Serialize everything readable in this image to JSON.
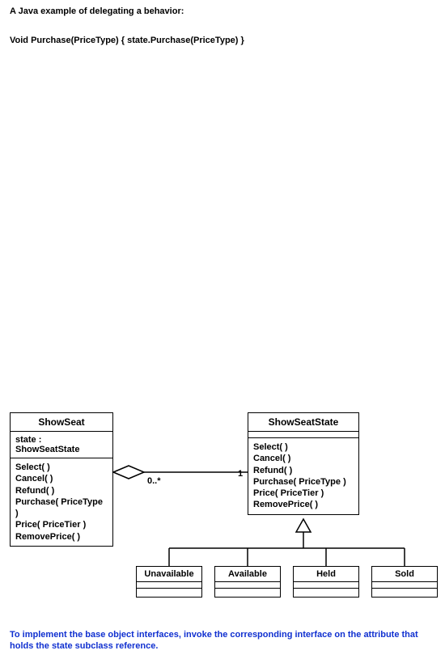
{
  "intro": "A Java example of delegating a behavior:",
  "code": "Void Purchase(PriceType) { state.Purchase(PriceType) }",
  "showSeat": {
    "name": "ShowSeat",
    "attr": "state  :  ShowSeatState",
    "ops": [
      "Select( )",
      "Cancel( )",
      "Refund( )",
      "Purchase( PriceType )",
      "Price( PriceTier )",
      "RemovePrice( )"
    ]
  },
  "showSeatState": {
    "name": "ShowSeatState",
    "ops": [
      "Select( )",
      "Cancel( )",
      "Refund( )",
      "Purchase( PriceType )",
      "Price( PriceTier )",
      "RemovePrice( )"
    ]
  },
  "subclasses": [
    "Unavailable",
    "Available",
    "Held",
    "Sold"
  ],
  "multiplicity": {
    "left": "0..*",
    "right": "1"
  },
  "footer": "To implement the base object interfaces, invoke the corresponding interface on the attribute that holds the state subclass reference.",
  "chart_data": {
    "type": "uml",
    "classes": [
      {
        "name": "ShowSeat",
        "attributes": [
          "state : ShowSeatState"
        ],
        "operations": [
          "Select()",
          "Cancel()",
          "Refund()",
          "Purchase(PriceType)",
          "Price(PriceTier)",
          "RemovePrice()"
        ]
      },
      {
        "name": "ShowSeatState",
        "attributes": [],
        "operations": [
          "Select()",
          "Cancel()",
          "Refund()",
          "Purchase(PriceType)",
          "Price(PriceTier)",
          "RemovePrice()"
        ]
      },
      {
        "name": "Unavailable",
        "attributes": [],
        "operations": []
      },
      {
        "name": "Available",
        "attributes": [],
        "operations": []
      },
      {
        "name": "Held",
        "attributes": [],
        "operations": []
      },
      {
        "name": "Sold",
        "attributes": [],
        "operations": []
      }
    ],
    "relationships": [
      {
        "type": "aggregation",
        "from": "ShowSeat",
        "to": "ShowSeatState",
        "multiplicity_from": "0..*",
        "multiplicity_to": "1"
      },
      {
        "type": "generalization",
        "from": "Unavailable",
        "to": "ShowSeatState"
      },
      {
        "type": "generalization",
        "from": "Available",
        "to": "ShowSeatState"
      },
      {
        "type": "generalization",
        "from": "Held",
        "to": "ShowSeatState"
      },
      {
        "type": "generalization",
        "from": "Sold",
        "to": "ShowSeatState"
      }
    ]
  }
}
